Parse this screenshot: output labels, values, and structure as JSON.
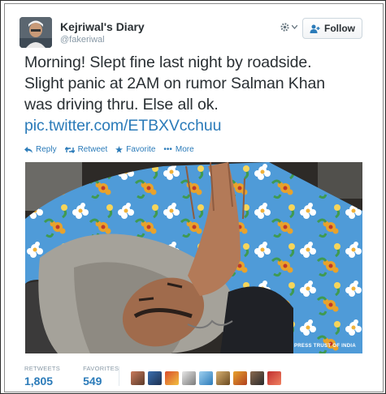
{
  "profile": {
    "display_name": "Kejriwal's Diary",
    "handle": "@fakeriwal"
  },
  "header": {
    "gear_icon": "gear-icon",
    "follow_label": "Follow"
  },
  "tweet": {
    "lines": [
      "Morning! Slept fine last night by roadside.",
      "Slight panic at 2AM on rumor Salman Khan",
      "was driving thru. Else all ok."
    ],
    "link": "pic.twitter.com/ETBXVcchuu"
  },
  "actions": {
    "reply": "Reply",
    "retweet": "Retweet",
    "favorite": "Favorite",
    "more": "More"
  },
  "photo": {
    "watermark": "PRESS TRUST OF INDIA"
  },
  "stats": {
    "retweets_label": "RETWEETS",
    "retweets_value": "1,805",
    "favorites_label": "FAVORITES",
    "favorites_value": "549"
  },
  "colors": {
    "link": "#2b7bb9",
    "text": "#292f33",
    "muted": "#8899a6"
  }
}
